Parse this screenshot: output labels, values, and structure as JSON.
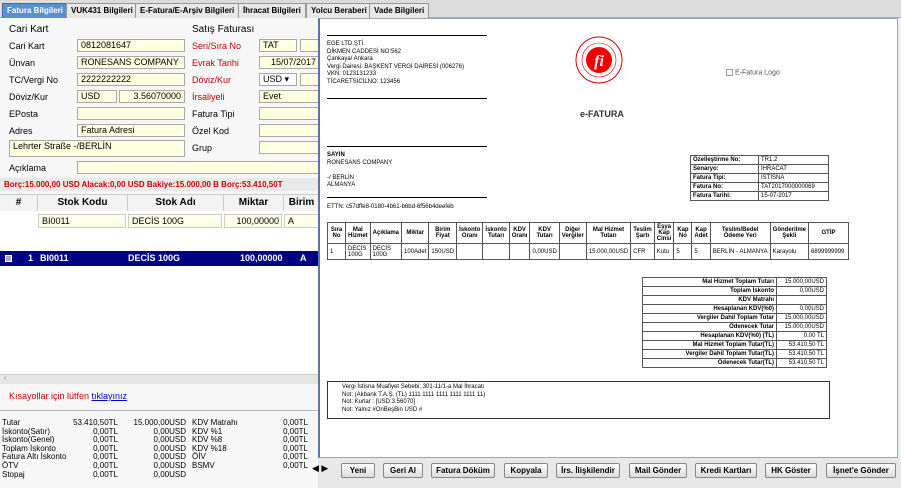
{
  "tabs": [
    "Fatura Bilgileri",
    "VUK431 Bilgileri",
    "E-Fatura/E-Arşiv Bilgileri",
    "İhracat Bilgileri",
    "Yolcu Beraberi",
    "Vade Bilgileri"
  ],
  "form": {
    "cari_header": "Cari Kart",
    "satis_header": "Satış Faturası",
    "cari_kart_label": "Cari Kart",
    "cari_kart_value": "0812081647",
    "unvan_label": "Ünvan",
    "unvan_value": "RONESANS COMPANY",
    "tc_label": "TC/Vergi No",
    "tc_value": "2222222222",
    "doviz_label": "Döviz/Kur",
    "doviz_currency": "USD",
    "doviz_rate": "3.56070000",
    "eposta_label": "EPosta",
    "adres_label": "Adres",
    "adres_value": "Fatura Adresi",
    "adres_text": "Lehrter Straße -/BERLİN",
    "aciklama_label": "Açıklama",
    "seri_label": "Seri/Sıra No",
    "seri_value": "TAT",
    "evrak_label": "Evrak Tarihi",
    "evrak_value": "15/07/2017",
    "dovizkur_label": "Döviz/Kur",
    "dovizkur_value": "USD ▾",
    "irsaliye_label": "İrsaliyeli",
    "irsaliye_value": "Evet",
    "fatura_tipi_label": "Fatura Tipi",
    "ozel_kod_label": "Özel Kod",
    "grup_label": "Grup"
  },
  "balance": "Borç:15.000,00 USD   Alacak:0,00 USD   Bakiye:15.000,00 B      Borç:53.410,50T",
  "grid": {
    "headers": [
      "#",
      "Stok Kodu",
      "Stok Adı",
      "Miktar",
      "Birim"
    ],
    "filter": {
      "code": "BI0011",
      "name": "DECİS 100G",
      "qty": "100,00000",
      "unit": "A"
    },
    "row": {
      "num": "1",
      "code": "BI0011",
      "name": "DECİS 100G",
      "qty": "100,00000",
      "unit": "A"
    }
  },
  "shortcut": {
    "text": "Kısayollar için lütfen ",
    "link": "tıklayınız"
  },
  "totals": [
    {
      "label": "Tutar",
      "tl": "53.410,50TL",
      "usd": "15.000,00USD",
      "l2": "KDV Matrahı",
      "v2": "0,00TL"
    },
    {
      "label": "İskonto(Satır)",
      "tl": "0,00TL",
      "usd": "0,00USD",
      "l2": "KDV %1",
      "v2": "0,00TL"
    },
    {
      "label": "İskonto(Genel)",
      "tl": "0,00TL",
      "usd": "0,00USD",
      "l2": "KDV %8",
      "v2": "0,00TL"
    },
    {
      "label": "Toplam İskonto",
      "tl": "0,00TL",
      "usd": "0,00USD",
      "l2": "KDV %18",
      "v2": "0,00TL"
    },
    {
      "label": "Fatura Altı İskonto",
      "tl": "0,00TL",
      "usd": "0,00USD",
      "l2": "ÖİV",
      "v2": "0,00TL"
    },
    {
      "label": "ÖTV",
      "tl": "0,00TL",
      "usd": "0,00USD",
      "l2": "BSMV",
      "v2": "0,00TL"
    },
    {
      "label": "Stopaj",
      "tl": "0,00TL",
      "usd": "0,00USD",
      "l2": "",
      "v2": ""
    }
  ],
  "doc": {
    "company": [
      "EGE LTD.ŞTİ.",
      "DİKMEN CADDESİ NO:562",
      "Çankaya/ Ankara",
      "Vergi Dairesi: BAŞKENT VERGİ DAİRESİ (006276)",
      "VKN: 0123131233",
      "TİCARETSİCİLNO: 123456"
    ],
    "efatura": "e-FATURA",
    "logo_alt": "E-Fatura Logo",
    "sayin": [
      "SAYIN",
      "RONESANS COMPANY",
      "",
      "-/ BERLİN",
      "ALMANYA"
    ],
    "ettn": "ETTN: c57dffe8-0180-4b61-b6bd-6f56b4deefeb",
    "info": [
      [
        "Özelleştirme No:",
        "TR1.2"
      ],
      [
        "Senaryo:",
        "İHRACAT"
      ],
      [
        "Fatura Tipi:",
        "İSTİSNA"
      ],
      [
        "Fatura No:",
        "TAT2017000000069"
      ],
      [
        "Fatura Tarihi:",
        "15-07-2017"
      ]
    ],
    "table_headers": [
      "Sıra No",
      "Mal Hizmet",
      "Açıklama",
      "Miktar",
      "Birim Fiyat",
      "İskonto Oranı",
      "İskonto Tutarı",
      "KDV Oranı",
      "KDV Tutarı",
      "Diğer Vergiler",
      "Mal Hizmet Tutarı",
      "Teslim Şartı",
      "Eşya Kap Cinsi",
      "Kap No",
      "Kap Adet",
      "Teslim/Bedel Ödeme Yeri",
      "Gönderilme Şekli",
      "GTİP"
    ],
    "table_row": [
      "1",
      "DECİS 100G",
      "DECİS 100G",
      "100Adet",
      "150USD",
      "",
      "",
      "",
      "0,00USD",
      "",
      "15.000,00USD",
      "CFR",
      "Kutu",
      "5",
      "5",
      "BERLİN - ALMANYA",
      "Karayolu",
      "6899999999"
    ],
    "sums": [
      [
        "Mal Hizmet Toplam Tutarı",
        "15.000,00USD"
      ],
      [
        "Toplam İskonto",
        "0,00USD"
      ],
      [
        "KDV Matrahı",
        ""
      ],
      [
        "Hesaplanan KDV(%0)",
        "0,00USD"
      ],
      [
        "Vergiler Dahil Toplam Tutar",
        "15.000,00USD"
      ],
      [
        "Ödenecek Tutar",
        "15.000,00USD"
      ],
      [
        "Hesaplanan KDV(%0) (TL)",
        "0,00 TL"
      ],
      [
        "Mal Hizmet Toplam Tutar(TL)",
        "53.410,50 TL"
      ],
      [
        "Vergiler Dahil Toplam Tutar(TL)",
        "53.410,50 TL"
      ],
      [
        "Ödenecek Tutar(TL)",
        "53.410,50 TL"
      ]
    ],
    "notes": [
      "Vergi İstisna Muafiyet Sebebi: 301-11/1-a Mal İhracatı",
      "Not: (Akbank T.A.Ş. (TL) 1111 1111 1111 1111 1111 11)",
      "Not: Kurlar : [USD:3.56070]",
      "Not: Yalnız #OnBeşBin USD #"
    ]
  },
  "buttons": [
    "Yeni",
    "Geri Al",
    "Fatura Döküm",
    "Kopyala",
    "İrs. İlişkilendir",
    "Mail Gönder",
    "Kredi Kartları",
    "HK Göster",
    "İşnet'e Gönder"
  ],
  "nav_arrows": "◀ ▶"
}
